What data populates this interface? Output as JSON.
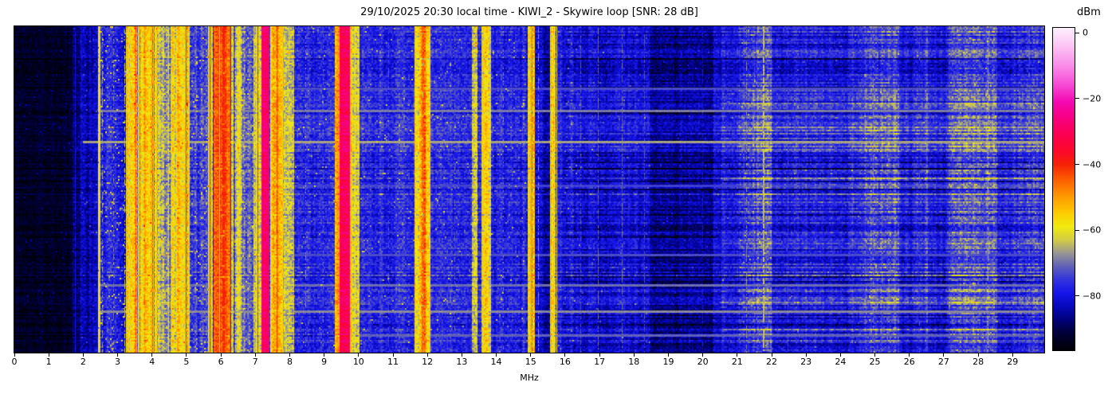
{
  "figure": {
    "title": "29/10/2025 20:30 local time - KIWI_2 - Skywire loop [SNR: 28 dB]",
    "xlabel": "MHz",
    "colorbar_label": "dBm"
  },
  "chart_data": {
    "type": "heatmap",
    "subtype": "radio-spectrum-waterfall",
    "title": "29/10/2025 20:30 local time - KIWI_2 - Skywire loop [SNR: 28 dB]",
    "xlabel": "MHz",
    "ylabel": "",
    "x_range_mhz": [
      0,
      29.92
    ],
    "x_ticks": [
      0,
      1,
      2,
      3,
      4,
      5,
      6,
      7,
      8,
      9,
      10,
      11,
      12,
      13,
      14,
      15,
      16,
      17,
      18,
      19,
      20,
      21,
      22,
      23,
      24,
      25,
      26,
      27,
      28,
      29
    ],
    "colorbar": {
      "label": "dBm",
      "tick_values": [
        0,
        -20,
        -40,
        -60,
        -80
      ],
      "tick_labels": [
        "0",
        "−20",
        "−40",
        "−60",
        "−80"
      ],
      "vtop": 1.5,
      "vbottom": -96.5
    },
    "colormap_stops": [
      [
        1.5,
        253,
        242,
        253
      ],
      [
        -4,
        252,
        196,
        245
      ],
      [
        -10,
        250,
        140,
        233
      ],
      [
        -16,
        247,
        72,
        212
      ],
      [
        -21,
        244,
        8,
        178
      ],
      [
        -26,
        247,
        0,
        128
      ],
      [
        -31,
        251,
        0,
        80
      ],
      [
        -36,
        252,
        8,
        44
      ],
      [
        -40,
        246,
        34,
        6
      ],
      [
        -45,
        254,
        98,
        0
      ],
      [
        -50,
        255,
        156,
        0
      ],
      [
        -55,
        253,
        206,
        0
      ],
      [
        -59,
        240,
        235,
        16
      ],
      [
        -63,
        210,
        204,
        70
      ],
      [
        -67,
        152,
        150,
        148
      ],
      [
        -71,
        96,
        97,
        184
      ],
      [
        -75,
        52,
        52,
        222
      ],
      [
        -79,
        22,
        22,
        233
      ],
      [
        -83,
        8,
        8,
        192
      ],
      [
        -87,
        1,
        1,
        126
      ],
      [
        -91,
        0,
        0,
        60
      ],
      [
        -96,
        0,
        0,
        8
      ]
    ],
    "bands": [
      [
        0.0,
        1.7,
        -93,
        1,
        2.5,
        0.02,
        6
      ],
      [
        1.7,
        1.92,
        -88,
        1.5,
        3,
        0.03,
        6
      ],
      [
        1.92,
        2.44,
        -84,
        2.5,
        3.5,
        0.03,
        8
      ],
      [
        2.44,
        2.5,
        -63,
        3,
        4,
        0,
        0
      ],
      [
        2.5,
        3.25,
        -78,
        3,
        5,
        0.05,
        15
      ],
      [
        3.25,
        4.15,
        -56,
        8,
        5,
        0.02,
        8
      ],
      [
        4.15,
        4.55,
        -68,
        6,
        5,
        0.05,
        10
      ],
      [
        4.55,
        5.1,
        -59,
        7,
        5,
        0.02,
        8
      ],
      [
        5.1,
        5.62,
        -75,
        4,
        5,
        0.05,
        12
      ],
      [
        5.62,
        5.8,
        -60,
        5,
        4,
        0,
        0
      ],
      [
        5.8,
        6.28,
        -44,
        5,
        4,
        0,
        0
      ],
      [
        6.28,
        6.62,
        -62,
        6,
        5,
        0.02,
        8
      ],
      [
        6.62,
        6.95,
        -70,
        5,
        5,
        0.04,
        10
      ],
      [
        6.95,
        7.18,
        -61,
        5,
        5,
        0.02,
        8
      ],
      [
        7.18,
        7.42,
        -28,
        2,
        3,
        0,
        0
      ],
      [
        7.42,
        7.62,
        -56,
        5,
        5,
        0,
        0
      ],
      [
        7.62,
        7.8,
        -53,
        6,
        5,
        0,
        0
      ],
      [
        7.8,
        8.12,
        -64,
        6,
        5,
        0.03,
        8
      ],
      [
        8.12,
        9.32,
        -77,
        2.5,
        4.5,
        0.02,
        10
      ],
      [
        9.32,
        9.46,
        -55,
        5,
        5,
        0,
        0
      ],
      [
        9.46,
        9.74,
        -30,
        3,
        3,
        0,
        0
      ],
      [
        9.74,
        10.02,
        -59,
        6,
        5,
        0,
        0
      ],
      [
        10.02,
        11.62,
        -77,
        2.5,
        4.5,
        0.02,
        10
      ],
      [
        11.62,
        11.76,
        -57,
        4,
        5,
        0,
        0
      ],
      [
        11.76,
        11.94,
        -49,
        5,
        5,
        0,
        0
      ],
      [
        11.94,
        12.1,
        -60,
        5,
        5,
        0,
        0
      ],
      [
        12.1,
        13.3,
        -77,
        2.5,
        4.5,
        0.02,
        10
      ],
      [
        13.3,
        13.46,
        -64,
        4,
        5,
        0.05,
        10
      ],
      [
        13.46,
        13.56,
        -75,
        3,
        4.5,
        0,
        0
      ],
      [
        13.56,
        13.84,
        -58,
        5,
        5,
        0,
        0
      ],
      [
        13.84,
        14.92,
        -78,
        3,
        4.5,
        0.02,
        10
      ],
      [
        14.92,
        15.12,
        -55,
        4,
        5,
        0,
        0
      ],
      [
        15.12,
        15.56,
        -83,
        3,
        4,
        0.01,
        8
      ],
      [
        15.56,
        15.76,
        -60,
        4,
        5,
        0,
        0
      ],
      [
        15.76,
        16.3,
        -79,
        3,
        4.5,
        0.02,
        8
      ],
      [
        16.3,
        18.45,
        -81,
        2.5,
        4,
        0.01,
        8
      ],
      [
        18.45,
        20.3,
        -86,
        2,
        3.5,
        0.01,
        6
      ],
      [
        20.3,
        20.55,
        -82,
        2,
        3.5,
        0.01,
        6
      ],
      [
        20.55,
        21.05,
        -79,
        2.5,
        4,
        0.01,
        6
      ],
      [
        21.05,
        21.55,
        -76,
        3,
        4.5,
        0.02,
        7
      ],
      [
        21.55,
        22.0,
        -72,
        3,
        4.5,
        0.02,
        7
      ],
      [
        22.0,
        24.35,
        -79,
        2.5,
        4,
        0.01,
        6
      ],
      [
        24.35,
        24.7,
        -76,
        3,
        4,
        0.01,
        6
      ],
      [
        24.7,
        25.7,
        -74,
        3,
        4.5,
        0.02,
        7
      ],
      [
        25.7,
        26.08,
        -79,
        2.5,
        4,
        0,
        0
      ],
      [
        26.08,
        26.55,
        -76,
        3,
        4,
        0.01,
        6
      ],
      [
        26.55,
        27.15,
        -79,
        2.5,
        4,
        0,
        0
      ],
      [
        27.15,
        28.55,
        -72,
        3,
        4.5,
        0.02,
        7
      ],
      [
        28.55,
        29.15,
        -78,
        2.5,
        4,
        0.01,
        6
      ],
      [
        29.15,
        29.92,
        -76,
        3,
        4.5,
        0.01,
        6
      ]
    ],
    "carrier_lines": [
      [
        1.76,
        1,
        -80,
        0.9
      ],
      [
        2.45,
        2,
        -58,
        0.95
      ],
      [
        2.56,
        1,
        -66,
        0.5
      ],
      [
        2.88,
        1,
        -68,
        0.4
      ],
      [
        3.2,
        1,
        -63,
        0.6
      ],
      [
        4.47,
        1,
        -60,
        0.7
      ],
      [
        5.06,
        1,
        -60,
        0.6
      ],
      [
        6.07,
        3,
        -40,
        0.9
      ],
      [
        7.65,
        2,
        -48,
        0.9
      ],
      [
        7.74,
        1,
        -56,
        0.7
      ],
      [
        7.97,
        1,
        -62,
        0.5
      ],
      [
        8.47,
        1,
        -68,
        0.4
      ],
      [
        8.97,
        1,
        -70,
        0.35
      ],
      [
        9.4,
        2,
        -50,
        0.9
      ],
      [
        9.78,
        1,
        -56,
        0.8
      ],
      [
        9.9,
        1,
        -57,
        0.7
      ],
      [
        10.0,
        1,
        -64,
        0.4
      ],
      [
        10.87,
        1,
        -72,
        0.4
      ],
      [
        11.67,
        1,
        -56,
        0.8
      ],
      [
        11.85,
        2,
        -45,
        0.85
      ],
      [
        12.0,
        1,
        -59,
        0.6
      ],
      [
        12.79,
        1,
        -70,
        0.3
      ],
      [
        13.35,
        1,
        -62,
        0.5
      ],
      [
        13.62,
        2,
        -55,
        0.8
      ],
      [
        13.74,
        1,
        -58,
        0.7
      ],
      [
        14.21,
        1,
        -68,
        0.3
      ],
      [
        15.0,
        2,
        -52,
        0.95
      ],
      [
        15.03,
        1,
        -45,
        0.25
      ],
      [
        15.22,
        1,
        -68,
        0.6
      ],
      [
        15.66,
        2,
        -58,
        0.9
      ],
      [
        16.45,
        1,
        -72,
        0.5
      ],
      [
        16.97,
        1,
        -71,
        0.7
      ],
      [
        17.66,
        1,
        -71,
        0.7
      ],
      [
        18.31,
        1,
        -73,
        0.6
      ],
      [
        20.0,
        1,
        -79,
        0.5
      ],
      [
        21.27,
        1,
        -68,
        0.6
      ],
      [
        21.77,
        2,
        -64,
        0.8
      ],
      [
        22.47,
        1,
        -75,
        0.4
      ],
      [
        24.95,
        1,
        -69,
        0.5
      ],
      [
        26.3,
        1,
        -73,
        0.4
      ],
      [
        28.28,
        1,
        -66,
        0.6
      ],
      [
        29.5,
        1,
        -73,
        0.4
      ]
    ],
    "h_streaks": [
      [
        78,
        1,
        -73,
        3.3,
        29.92
      ],
      [
        106,
        1,
        -69,
        2.5,
        29.92
      ],
      [
        145,
        1,
        -66,
        2.0,
        29.92
      ],
      [
        200,
        1,
        -74,
        8.0,
        29.92
      ],
      [
        287,
        1,
        -73,
        8.0,
        29.92
      ],
      [
        325,
        1,
        -70,
        2.5,
        29.92
      ],
      [
        358,
        1,
        -68,
        2.5,
        29.92
      ],
      [
        388,
        1,
        -71,
        10.0,
        29.92
      ]
    ],
    "row_amp": [
      [
        8,
        1.5
      ],
      [
        16,
        2.5
      ],
      [
        21,
        4
      ],
      [
        29.92,
        5.5
      ]
    ],
    "row_bonus_fmin": 20.5,
    "seed": 7
  }
}
